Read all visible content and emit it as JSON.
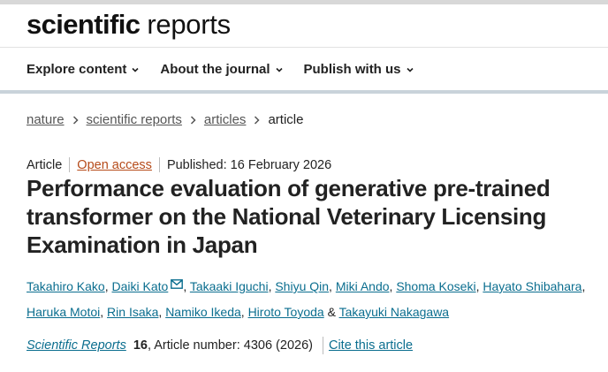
{
  "brand": {
    "bold": "scientific",
    "light": "reports"
  },
  "nav": [
    {
      "label": "Explore content"
    },
    {
      "label": "About the journal"
    },
    {
      "label": "Publish with us"
    }
  ],
  "breadcrumb": {
    "items": [
      "nature",
      "scientific reports",
      "articles"
    ],
    "current": "article"
  },
  "meta": {
    "type": "Article",
    "access": "Open access",
    "published": "Published: 16 February 2026"
  },
  "title": "Performance evaluation of generative pre-trained transformer on the National Veterinary Licensing Examination in Japan",
  "authors": [
    "Takahiro Kako",
    "Daiki Kato",
    "Takaaki Iguchi",
    "Shiyu Qin",
    "Miki Ando",
    "Shoma Koseki",
    "Hayato Shibahara",
    "Haruka Motoi",
    "Rin Isaka",
    "Namiko Ikeda",
    "Hiroto Toyoda",
    "Takayuki Nakagawa"
  ],
  "author_separators": {
    "comma": ", ",
    "and": " & "
  },
  "citation": {
    "journal": "Scientific Reports",
    "volume": "16",
    "article_number": ", Article number: 4306 (2026)",
    "cite_label": "Cite this article"
  },
  "colors": {
    "link": "#0b6e8f",
    "open_access": "#b64b1a",
    "nav_divider": "#c9d3da"
  },
  "icons": {
    "chevron": "chevron-down-icon",
    "breadcrumb": "chevron-right-icon",
    "email": "mail-icon"
  }
}
